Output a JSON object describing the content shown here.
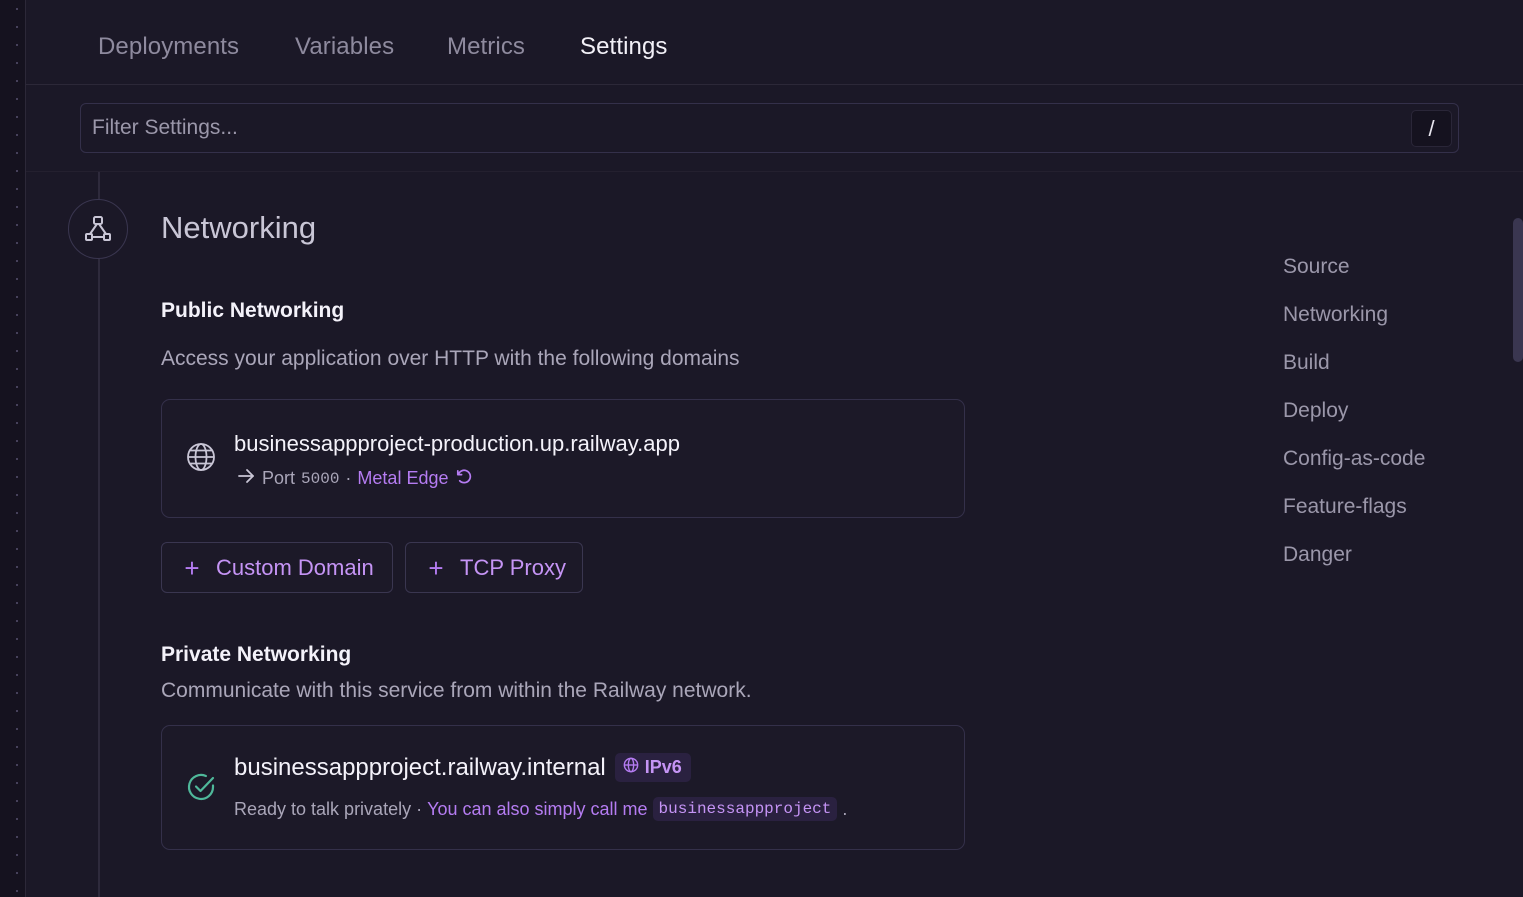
{
  "tabs": [
    {
      "label": "Deployments"
    },
    {
      "label": "Variables"
    },
    {
      "label": "Metrics"
    },
    {
      "label": "Settings",
      "active": true
    }
  ],
  "filter": {
    "placeholder": "Filter Settings...",
    "shortcut": "/"
  },
  "networking": {
    "title": "Networking",
    "public": {
      "title": "Public Networking",
      "description": "Access your application over HTTP with the following domains",
      "domain": "businessappproject-production.up.railway.app",
      "port_label": "Port",
      "port": "5000",
      "separator": "·",
      "edge": "Metal Edge",
      "buttons": {
        "custom_domain": "Custom Domain",
        "tcp_proxy": "TCP Proxy"
      }
    },
    "private": {
      "title": "Private Networking",
      "description": "Communicate with this service from within the Railway network.",
      "domain": "businessappproject.railway.internal",
      "badge": "IPv6",
      "status": "Ready to talk privately",
      "separator": "·",
      "alias_text": "You can also simply call me",
      "alias": "businessappproject",
      "period": "."
    }
  },
  "right_nav": [
    {
      "label": "Source"
    },
    {
      "label": "Networking"
    },
    {
      "label": "Build"
    },
    {
      "label": "Deploy"
    },
    {
      "label": "Config-as-code"
    },
    {
      "label": "Feature-flags"
    },
    {
      "label": "Danger"
    }
  ],
  "colors": {
    "background": "#1b1827",
    "accent": "#b57cf2",
    "success": "#4fb89a"
  },
  "icons": {
    "section": "network-nodes-icon",
    "public_domain": "globe-icon",
    "port_arrow": "arrow-right-icon",
    "edge": "rotate-ccw-icon",
    "add": "plus-icon",
    "private_status": "check-circle-icon",
    "ipv6": "globe-icon"
  }
}
